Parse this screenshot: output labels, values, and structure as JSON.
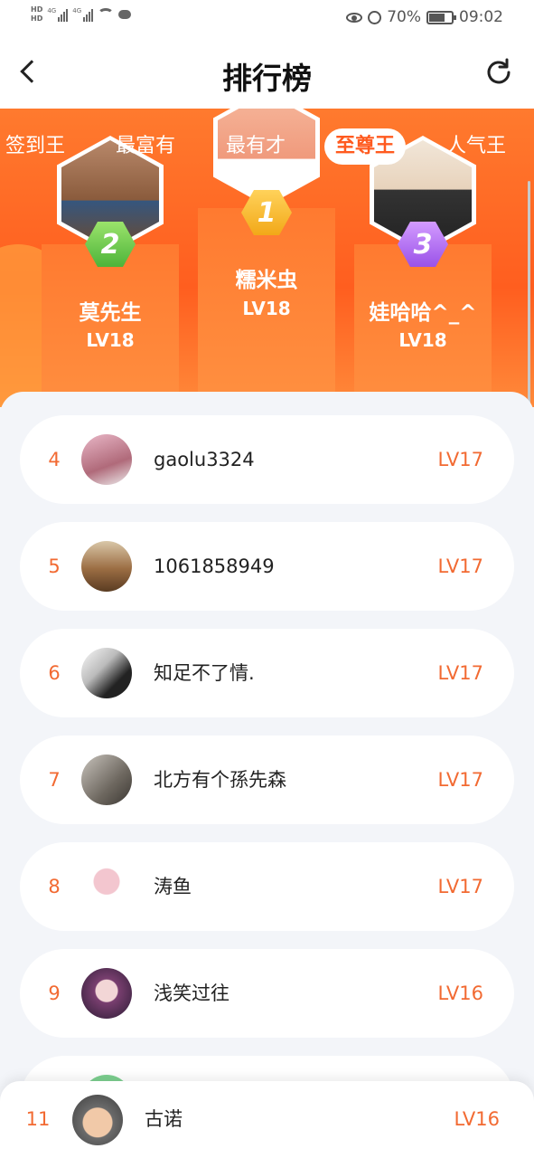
{
  "status_bar": {
    "hd1": "HD",
    "hd2": "HD",
    "net1": "4G",
    "net2": "4G",
    "battery_percent": "70%",
    "battery_level": 0.7,
    "time": "09:02"
  },
  "header": {
    "title": "排行榜"
  },
  "tabs": [
    {
      "label": "签到王"
    },
    {
      "label": "最富有"
    },
    {
      "label": "最有才"
    },
    {
      "label": "至尊王"
    },
    {
      "label": "人气王"
    }
  ],
  "active_tab": "至尊王",
  "podium": [
    {
      "rank": "1",
      "name": "糯米虫",
      "level": "LV18"
    },
    {
      "rank": "2",
      "name": "莫先生",
      "level": "LV18"
    },
    {
      "rank": "3",
      "name": "娃哈哈^_^",
      "level": "LV18"
    }
  ],
  "ranking": [
    {
      "rank": "4",
      "name": "gaolu3324",
      "level": "LV17",
      "color": "#c88"
    },
    {
      "rank": "5",
      "name": "1061858949",
      "level": "LV17",
      "color": "#a77d55"
    },
    {
      "rank": "6",
      "name": "知足不了情.",
      "level": "LV17",
      "color": "#333"
    },
    {
      "rank": "7",
      "name": "北方有个孫先森",
      "level": "LV17",
      "color": "#8a8580"
    },
    {
      "rank": "8",
      "name": "涛鱼",
      "level": "LV17",
      "color": "#f0d8d8"
    },
    {
      "rank": "9",
      "name": "浅笑过往",
      "level": "LV16",
      "color": "#6b3a5f"
    }
  ],
  "my_rank": {
    "rank": "11",
    "name": "古诺",
    "level": "LV16"
  }
}
